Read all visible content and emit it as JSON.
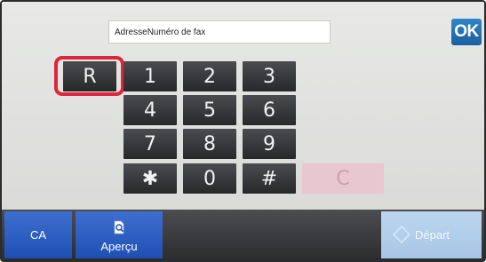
{
  "address": {
    "label": "Adresse",
    "value": "Numéro de fax"
  },
  "ok_label": "OK",
  "keypad": {
    "r": "R",
    "k1": "1",
    "k2": "2",
    "k3": "3",
    "k4": "4",
    "k5": "5",
    "k6": "6",
    "k7": "7",
    "k8": "8",
    "k9": "9",
    "star": "✱",
    "k0": "0",
    "hash": "#",
    "clear": "C"
  },
  "bottom": {
    "ca": "CA",
    "apercu": "Aperçu",
    "depart": "Départ"
  },
  "colors": {
    "highlight": "#e0253b",
    "ok": "#1c5f9b",
    "bottom_button": "#2a5cc0"
  },
  "icons": {
    "apercu": "preview-magnifier-icon",
    "depart": "start-diamond-icon"
  }
}
